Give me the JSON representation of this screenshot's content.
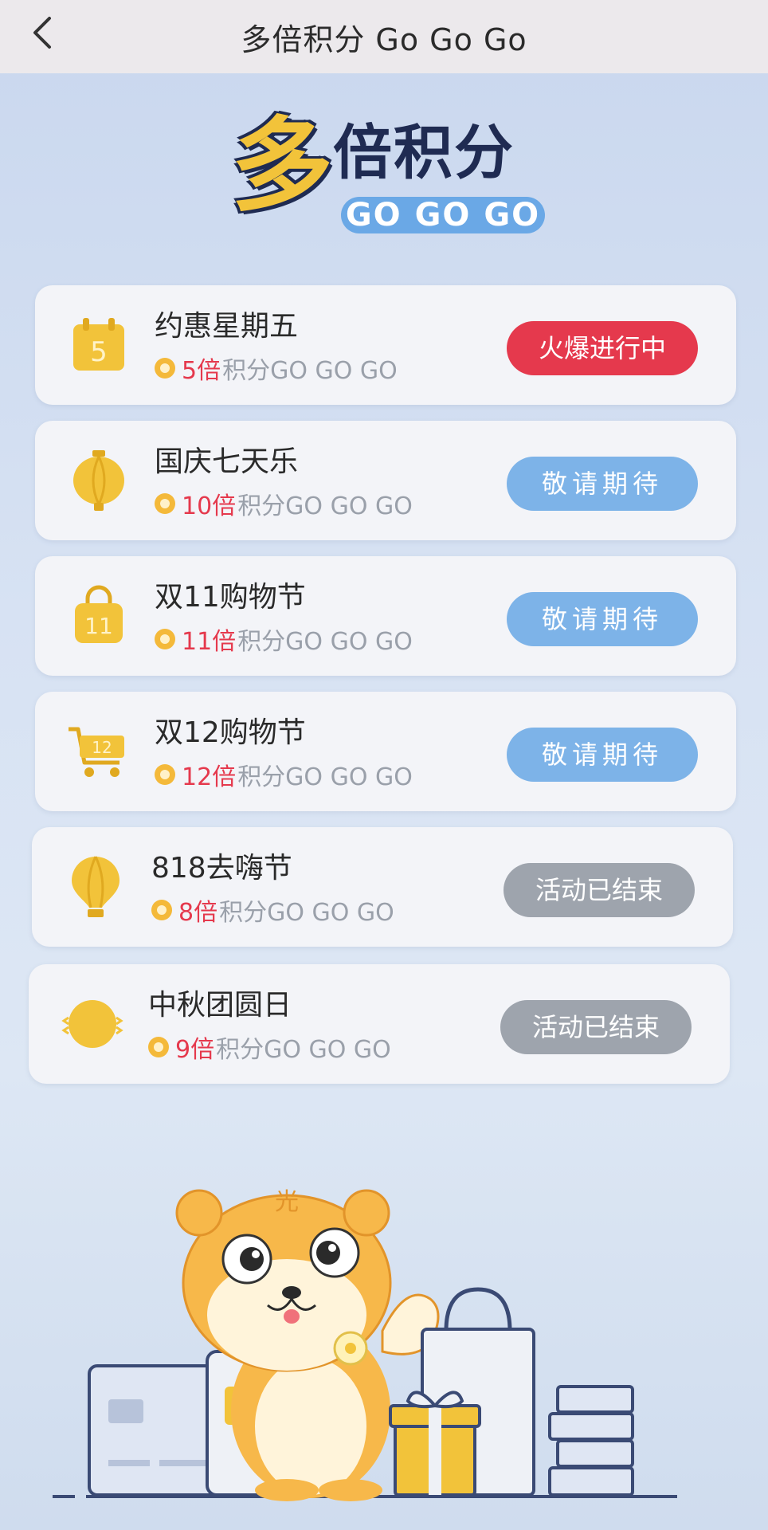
{
  "header": {
    "title": "多倍积分 Go Go Go",
    "back_icon": "chevron-left-icon"
  },
  "banner": {
    "big_char": "多",
    "rest_text": "倍积分",
    "gogo_text": "GO GO GO"
  },
  "colors": {
    "accent_red": "#e5394d",
    "soon_blue": "#7db3e8",
    "ended_gray": "#9ea4ad",
    "gold": "#f4b93a"
  },
  "events": [
    {
      "name": "约惠星期五",
      "multiplier": "5倍",
      "suffix": "积分GO GO GO",
      "status": "火爆进行中",
      "icon": "calendar-icon"
    },
    {
      "name": "国庆七天乐",
      "multiplier": "10倍",
      "suffix": "积分GO GO GO",
      "status": "敬请期待",
      "icon": "lantern-icon"
    },
    {
      "name": "双11购物节",
      "multiplier": "11倍",
      "suffix": "积分GO GO GO",
      "status": "敬请期待",
      "icon": "bag-icon"
    },
    {
      "name": "双12购物节",
      "multiplier": "12倍",
      "suffix": "积分GO GO GO",
      "status": "敬请期待",
      "icon": "cart-icon"
    },
    {
      "name": "818去嗨节",
      "multiplier": "8倍",
      "suffix": "积分GO GO GO",
      "status": "活动已结束",
      "icon": "balloon-icon"
    },
    {
      "name": "中秋团圆日",
      "multiplier": "9倍",
      "suffix": "积分GO GO GO",
      "status": "活动已结束",
      "icon": "moon-icon"
    }
  ],
  "mascot": {
    "badge_char": "光"
  }
}
